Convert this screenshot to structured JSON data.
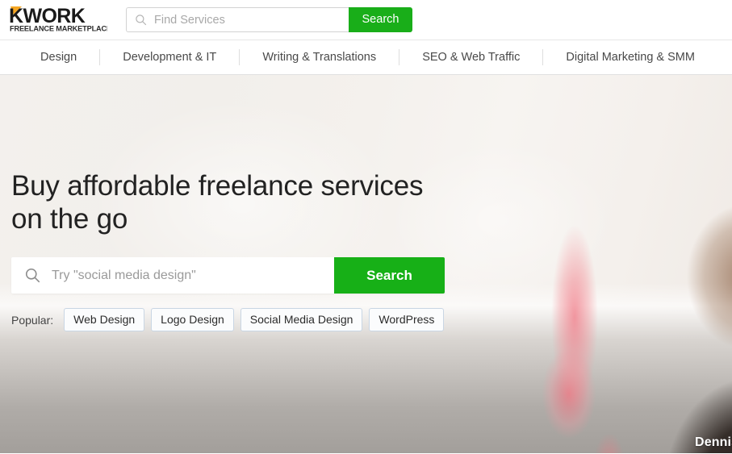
{
  "brand": {
    "name": "KWORK",
    "tagline": "FREELANCE MARKETPLACE",
    "accent_color": "#f5a623",
    "text_color": "#1a1a1a"
  },
  "header": {
    "search": {
      "placeholder": "Find Services",
      "value": "",
      "button_label": "Search",
      "icon": "search-icon",
      "button_color": "#19ae19"
    }
  },
  "category_nav": {
    "items": [
      {
        "label": "Design"
      },
      {
        "label": "Development & IT"
      },
      {
        "label": "Writing & Translations"
      },
      {
        "label": "SEO & Web Traffic"
      },
      {
        "label": "Digital Marketing & SMM"
      }
    ]
  },
  "hero": {
    "title_line1": "Buy affordable freelance services",
    "title_line2": "on the go",
    "search": {
      "placeholder": "Try \"social media design\"",
      "value": "",
      "button_label": "Search",
      "icon": "search-icon",
      "button_color": "#17b017"
    },
    "popular": {
      "label": "Popular:",
      "tags": [
        {
          "label": "Web Design"
        },
        {
          "label": "Logo Design"
        },
        {
          "label": "Social Media Design"
        },
        {
          "label": "WordPress"
        }
      ]
    },
    "credit_name": "Dennis"
  }
}
